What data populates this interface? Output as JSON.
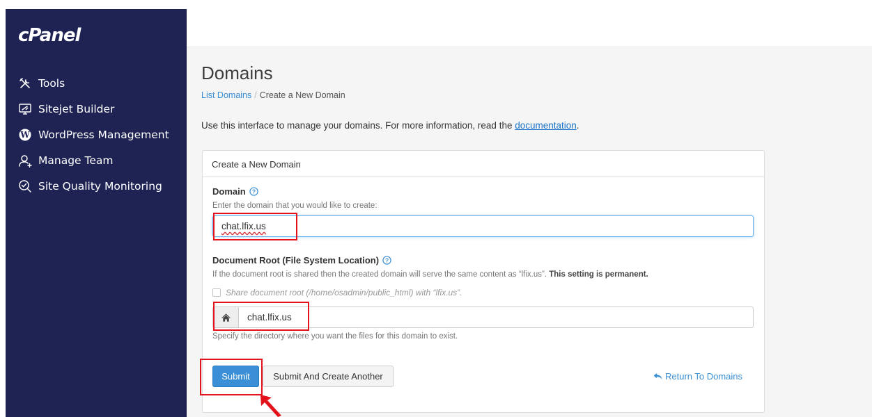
{
  "brand": {
    "logo_text": "cPanel"
  },
  "sidebar": {
    "items": [
      {
        "label": "Tools",
        "icon": "tools-icon"
      },
      {
        "label": "Sitejet Builder",
        "icon": "monitor-icon"
      },
      {
        "label": "WordPress Management",
        "icon": "wordpress-icon"
      },
      {
        "label": "Manage Team",
        "icon": "user-add-icon"
      },
      {
        "label": "Site Quality Monitoring",
        "icon": "search-check-icon"
      }
    ]
  },
  "page": {
    "title": "Domains",
    "breadcrumb": {
      "parent": "List Domains",
      "separator": "/",
      "current": "Create a New Domain"
    },
    "intro_text": "Use this interface to manage your domains. For more information, read the ",
    "intro_link": "documentation",
    "intro_end": "."
  },
  "form": {
    "panel_title": "Create a New Domain",
    "domain_label": "Domain",
    "domain_hint": "Enter the domain that you would like to create:",
    "domain_value": "chat.lfix.us",
    "docroot_label": "Document Root (File System Location)",
    "docroot_hint": "If the document root is shared then the created domain will serve the same content as “lfix.us”.",
    "docroot_hint_bold": "This setting is permanent.",
    "share_checkbox_label": "Share document root (/home/osadmin/public_html) with “lfix.us”.",
    "docroot_value": "chat.lfix.us",
    "docroot_help": "Specify the directory where you want the files for this domain to exist.",
    "submit_label": "Submit",
    "submit_another_label": "Submit And Create Another",
    "return_label": "Return To Domains"
  },
  "colors": {
    "sidebar_bg": "#1e2353",
    "primary": "#3a8fd6",
    "link": "#3b8fd4",
    "annotation": "#e3121b"
  }
}
